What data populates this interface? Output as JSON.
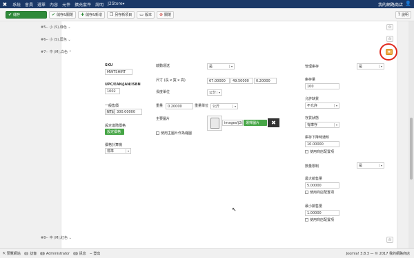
{
  "topbar": {
    "logo": "✖",
    "menu": [
      "系統",
      "會員",
      "選單",
      "內容",
      "元件",
      "擴充套件",
      "說明",
      "J2Store▾"
    ],
    "site": "我的網路商店",
    "user_icon": "👤"
  },
  "toolbar": {
    "save": "儲存",
    "save_close": "儲存&關閉",
    "save_new": "儲存&新增",
    "save_copy": "另存新項目",
    "version": "版本",
    "close": "關閉",
    "help": "說明"
  },
  "variants": {
    "v5": "#5-- 小 (S),綠色",
    "v6": "#6-- 小 (S),藍色",
    "v7": "#7-- 中 (M),白色",
    "v8": "#8-- 中 (M),紅色"
  },
  "form": {
    "sku_label": "SKU",
    "sku_value": "MWTSHIRT",
    "upc_label": "UPC/EAN/JAN/ISBN",
    "upc_value": "1002",
    "price_label": "一般售價",
    "currency": "NT$",
    "price_value": "300.00000",
    "advanced_price_label": "設定進階價格",
    "advanced_price_btn": "設定價格",
    "price_calc_label": "價格計算機",
    "price_calc_value": "標準",
    "shipping_label": "啟動運送",
    "shipping_value": "是",
    "dims_label": "尺寸 (長 x 寬 x 高)",
    "len": "67.00000",
    "wid": "49.50000",
    "hei": "0.20000",
    "length_unit_label": "長度單位",
    "length_unit_value": "公分",
    "weight_label": "重量",
    "weight_value": "0.20000",
    "weight_unit_label": "重量單位",
    "weight_unit_value": "公斤",
    "main_image_label": "主要圖片",
    "image_path": "images/j2t",
    "select_image_btn": "選擇圖片",
    "close_x": "✖",
    "use_main_image": "使用主圖片作為縮圖",
    "manage_stock_label": "管理庫存",
    "manage_stock_value": "是",
    "stock_qty_label": "庫存量",
    "stock_qty_value": "100",
    "backorder_label": "允許缺貨",
    "backorder_value": "不允許",
    "stock_status_label": "存貨狀態",
    "stock_status_value": "有庫存",
    "notify_label": "庫存下降時通知",
    "notify_value": "10.00000",
    "notify_cb": "使用商店配置項",
    "qty_limit_label": "數量限制",
    "qty_limit_value": "是",
    "max_label": "最大銷售量",
    "max_value": "5.00000",
    "max_cb": "使用商店配置項",
    "min_label": "最小銷售量",
    "min_value": "1.00000",
    "min_cb": "使用商店配置項"
  },
  "statusbar": {
    "view_site": "預覽網站",
    "visitors_count": "0",
    "visitors": "訪客",
    "admin_count": "1",
    "admin": "Administrator",
    "msg_count": "0",
    "messages": "訊息",
    "logout": "登出",
    "right": "Joomla! 3.8.3 — © 2017 我的網路商店"
  }
}
